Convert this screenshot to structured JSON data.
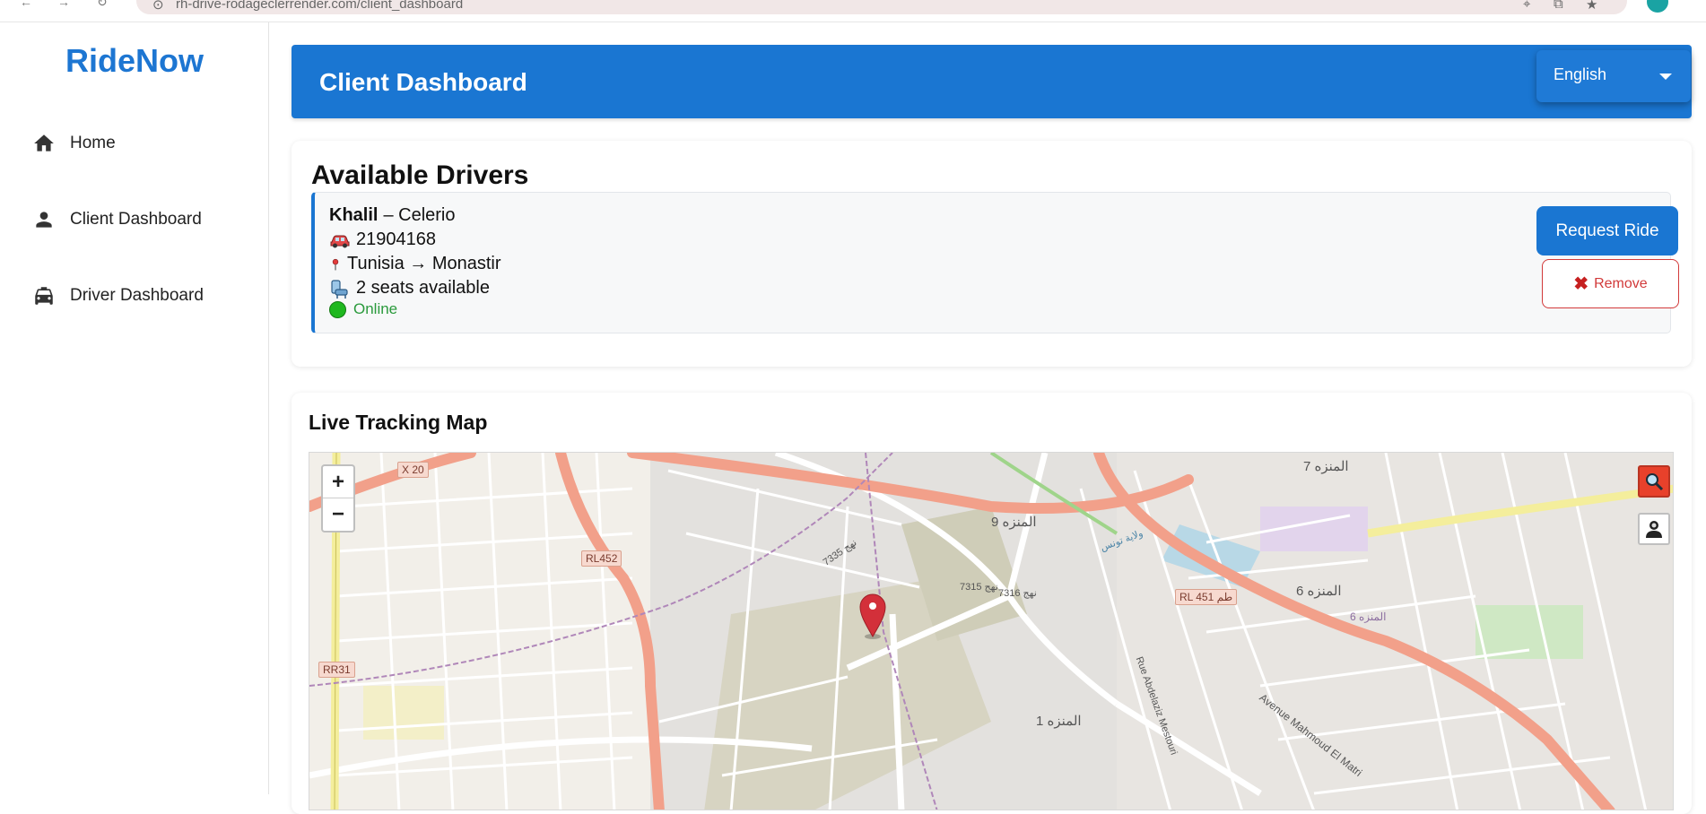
{
  "browser": {
    "url": "rh-drive-rodageclerrender.com/client_dashboard"
  },
  "sidebar": {
    "brand": "RideNow",
    "items": [
      {
        "label": "Home",
        "icon": "home-icon"
      },
      {
        "label": "Client Dashboard",
        "icon": "person-icon"
      },
      {
        "label": "Driver Dashboard",
        "icon": "taxi-icon"
      }
    ]
  },
  "header": {
    "title": "Client Dashboard",
    "language": "English"
  },
  "drivers": {
    "title": "Available Drivers",
    "list": [
      {
        "name": "Khalil",
        "car": "– Celerio",
        "phone": "21904168",
        "route": "Tunisia → Monastir",
        "seats": "2 seats available",
        "status": "Online",
        "request_label": "Request Ride",
        "remove_label": "Remove"
      }
    ]
  },
  "map": {
    "title": "Live Tracking Map",
    "zoom_in": "+",
    "zoom_out": "−",
    "labels": {
      "x20": "X 20",
      "rl452": "RL452",
      "rr31": "RR31",
      "rl451": "RL 451 طم",
      "menzah9": "المنزه 9",
      "menzah7": "المنزه 7",
      "menzah6": "المنزه 6",
      "menzah6b": "المنزه 6",
      "menzah1": "المنزه 1",
      "mahmoud": "Avenue Mahmoud El Matri",
      "abdelaziz": "Rue Abdelaziz Mestouri",
      "r7335": "نهج 7335",
      "r7315": "نهج 7315",
      "r7316": "نهج 7316",
      "cite": "ولاية تونس"
    }
  },
  "colors": {
    "brand": "#1d76d2",
    "header": "#1a76d2",
    "danger": "#d23a3a",
    "online": "#2a9a3c",
    "marker": "#d3303a"
  }
}
